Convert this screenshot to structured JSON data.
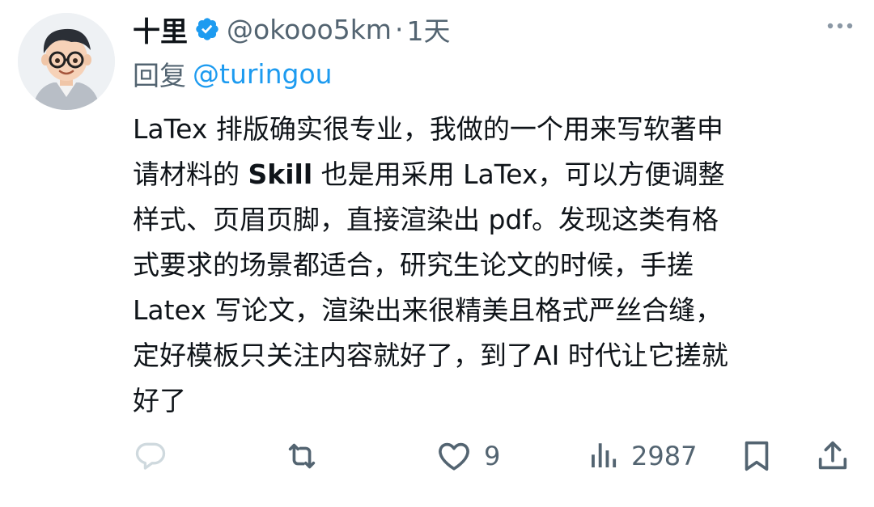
{
  "author": {
    "display_name": "十里",
    "handle": "@okooo5km",
    "separator": "·",
    "time": "1天",
    "avatar_icon": "cartoon-avatar-with-glasses",
    "verified_color": "#1d9bf0"
  },
  "reply": {
    "prefix": "回复",
    "mention": "@turingou"
  },
  "body": {
    "line1": "LaTex 排版确实很专业，我做的一个用来写软著申",
    "line2_a": "请材料的 ",
    "line2_bold": "Skill",
    "line2_b": " 也是用采用 LaTex，可以方便调整",
    "line3": "样式、页眉页脚，直接渲染出 pdf。发现这类有格",
    "line4": "式要求的场景都适合，研究生论文的时候，手搓",
    "line5": "Latex 写论文，渲染出来很精美且格式严丝合缝，",
    "line6": "定好模板只关注内容就好了，到了AI 时代让它搓就",
    "line7": "好了"
  },
  "actions": {
    "reply_icon": "reply-icon",
    "retweet_icon": "retweet-icon",
    "like_icon": "heart-icon",
    "like_count": "9",
    "views_icon": "views-icon",
    "views_count": "2987",
    "bookmark_icon": "bookmark-icon",
    "share_icon": "share-icon"
  },
  "colors": {
    "text": "#0f1419",
    "muted": "#536471",
    "accent": "#1d9bf0",
    "reply_icon_faded": "#cfd9de"
  }
}
